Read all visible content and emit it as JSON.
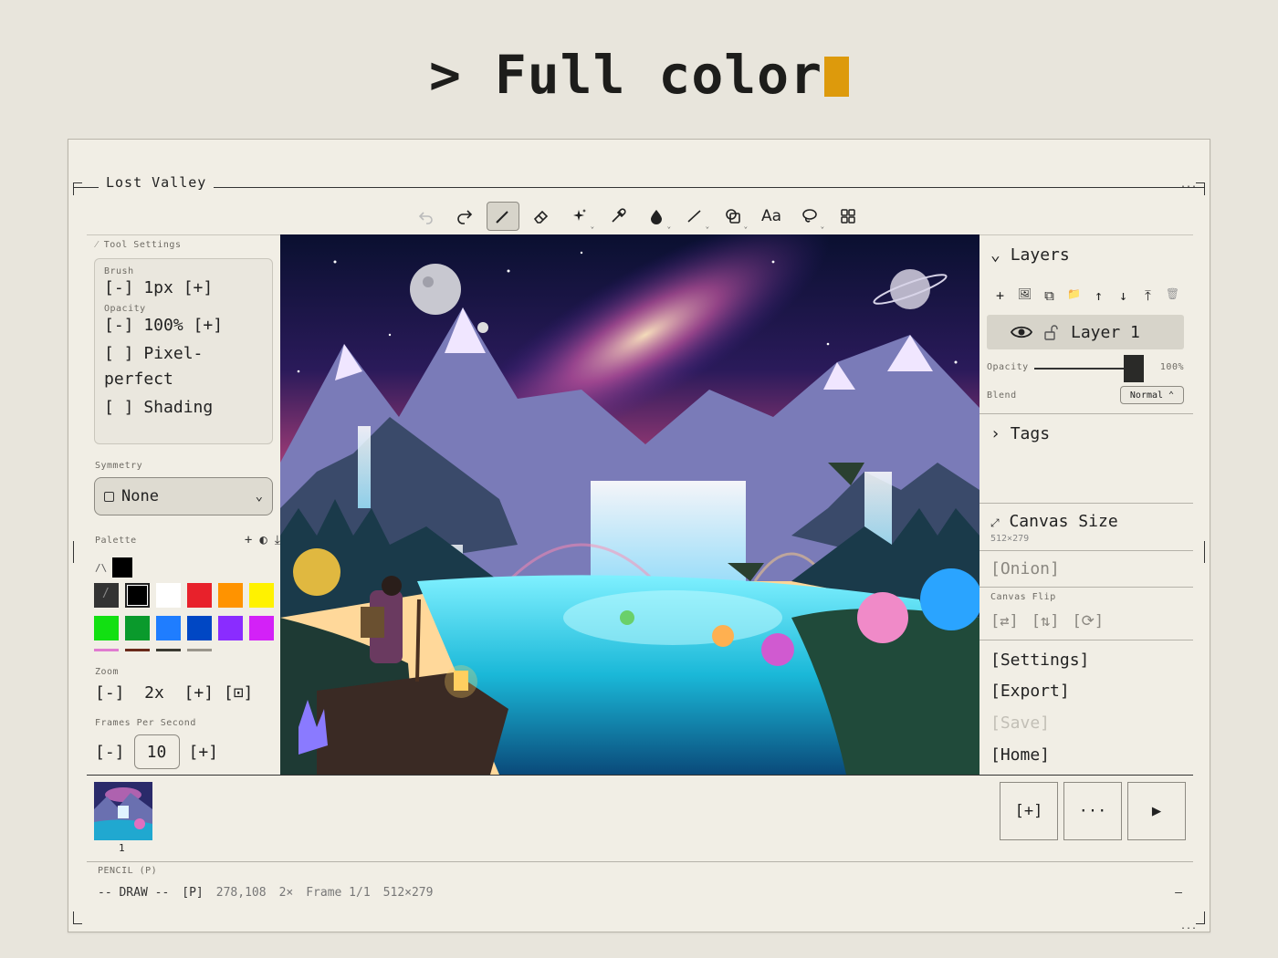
{
  "headline": {
    "prompt": ">",
    "text": "Full color"
  },
  "window": {
    "title": "Lost Valley",
    "dots": "..."
  },
  "toolbar": {
    "tools": [
      "undo-icon",
      "redo-icon",
      "pencil-icon",
      "eraser-icon",
      "magic-wand-icon",
      "eyedropper-icon",
      "fill-icon",
      "line-icon",
      "shapes-icon",
      "text-tool",
      "lasso-icon",
      "grid-icon"
    ],
    "text_tool_label": "Aa",
    "active": "pencil-icon"
  },
  "left": {
    "tool_settings_title": "Tool Settings",
    "brush_label": "Brush",
    "brush_value": "[-] 1px [+]",
    "opacity_label": "Opacity",
    "opacity_value": "[-] 100% [+]",
    "pixel_perfect": "[ ] Pixel-perfect",
    "shading": "[ ] Shading",
    "symmetry_label": "Symmetry",
    "symmetry_value": "None",
    "palette_label": "Palette",
    "palette_icons": [
      "+",
      "◐",
      "⤓"
    ],
    "fg_marker": "/\\",
    "swatches": [
      "#333333",
      "#000000",
      "#ffffff",
      "#e8212b",
      "#ff9300",
      "#fff200",
      "#12e012",
      "#0a9a2c",
      "#1f7dff",
      "#0047c4",
      "#8a2cff",
      "#d321f7"
    ],
    "zoom_label": "Zoom",
    "zoom_value": "[-]  2x  [+] [⊡]",
    "fps_label": "Frames Per Second",
    "fps_minus": "[-]",
    "fps_value": "10",
    "fps_plus": "[+]"
  },
  "right": {
    "layers_title": "Layers",
    "layer_tools": [
      "+",
      "🖼",
      "⧉",
      "📁",
      "↑",
      "↓",
      "⤒",
      "🗑"
    ],
    "layer_name": "Layer 1",
    "opacity_label": "Opacity",
    "opacity_value": "100%",
    "opacity_level": 1.0,
    "blend_label": "Blend",
    "blend_value": "Normal ⌃",
    "tags_title": "Tags",
    "canvas_size_title": "Canvas Size",
    "canvas_size_value": "512×279",
    "onion": "[Onion]",
    "canvas_flip_label": "Canvas Flip",
    "flip_buttons": [
      "[⇄]",
      "[⇅]",
      "[⟳]"
    ],
    "settings": "[Settings]",
    "export": "[Export]",
    "save": "[Save]",
    "home": "[Home]"
  },
  "timeline": {
    "frame_number": "1",
    "add_label": "[+]",
    "more_label": "···",
    "play_label": "▶"
  },
  "status": {
    "mode_label": "PENCIL (P)",
    "mode": "-- DRAW --",
    "tool_key": "[P]",
    "coords": "278,108",
    "zoom": "2×",
    "frame": "Frame 1/1",
    "size": "512×279",
    "right": "–"
  }
}
